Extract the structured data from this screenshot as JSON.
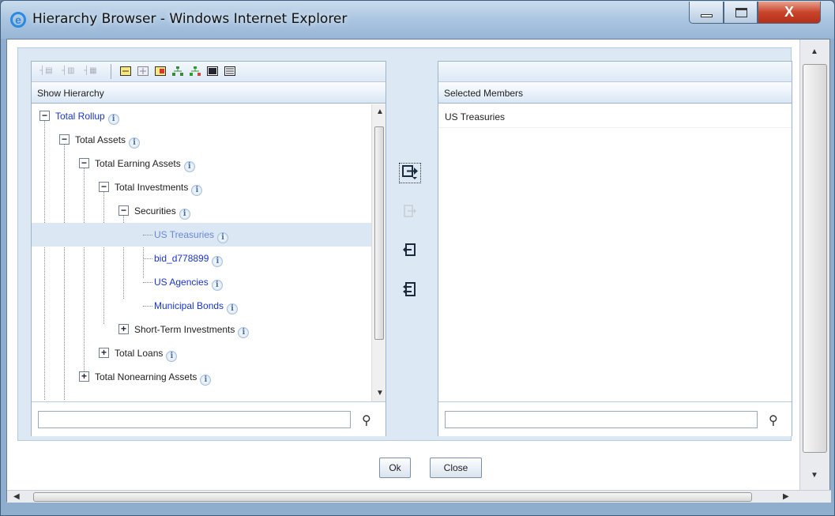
{
  "window": {
    "title": "Hierarchy Browser - Windows Internet Explorer",
    "close_glyph": "X"
  },
  "left_panel": {
    "header": "Show Hierarchy",
    "toolbar_icons": [
      "expand-all-icon",
      "collapse-icon",
      "collapse-all-icon",
      "collapse-node-icon",
      "expand-node-icon",
      "find-icon",
      "tree-icon",
      "tree-green-icon",
      "list-icon",
      "list-detail-icon"
    ],
    "tree": [
      {
        "label": "Total Rollup",
        "level": 0,
        "state": "expanded",
        "style": "link"
      },
      {
        "label": "Total Assets",
        "level": 1,
        "state": "expanded",
        "style": "plain"
      },
      {
        "label": "Total Earning Assets",
        "level": 2,
        "state": "expanded",
        "style": "plain"
      },
      {
        "label": "Total Investments",
        "level": 3,
        "state": "expanded",
        "style": "plain"
      },
      {
        "label": "Securities",
        "level": 4,
        "state": "expanded",
        "style": "plain"
      },
      {
        "label": "US Treasuries",
        "level": 5,
        "state": "leaf",
        "style": "selected"
      },
      {
        "label": "bid_d778899",
        "level": 5,
        "state": "leaf",
        "style": "link"
      },
      {
        "label": "US Agencies",
        "level": 5,
        "state": "leaf",
        "style": "link"
      },
      {
        "label": "Municipal Bonds",
        "level": 5,
        "state": "leaf",
        "style": "link"
      },
      {
        "label": "Short-Term Investments",
        "level": 4,
        "state": "collapsed",
        "style": "plain"
      },
      {
        "label": "Total Loans",
        "level": 3,
        "state": "collapsed",
        "style": "plain"
      },
      {
        "label": "Total Nonearning Assets",
        "level": 2,
        "state": "collapsed",
        "style": "plain"
      }
    ],
    "info_glyph": "i",
    "search_value": ""
  },
  "right_panel": {
    "header": "Selected Members",
    "items": [
      "US Treasuries"
    ],
    "search_value": ""
  },
  "movers": {
    "select_icon": "move-right-icon",
    "remove_icon": "remove-icon",
    "deselect_icon": "move-left-icon",
    "deselect_all_icon": "move-all-left-icon"
  },
  "buttons": {
    "ok": "Ok",
    "close": "Close"
  },
  "colors": {
    "link": "#1a35c8",
    "selected_text": "#6a86d8",
    "selected_row": "#dbe8f3",
    "panel_bg": "#dce9f4"
  }
}
